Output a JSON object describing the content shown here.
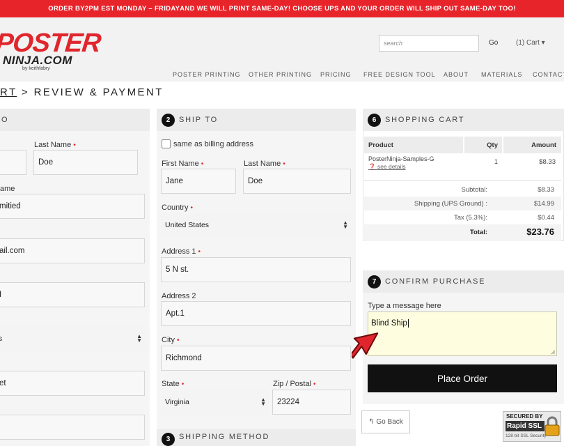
{
  "banner": {
    "text_prefix": "ORDER BY ",
    "text_bold": "2PM EST MONDAY – FRIDAY",
    "text_suffix": " AND WE WILL PRINT SAME-DAY! CHOOSE UPS AND YOUR ORDER WILL SHIP OUT SAME-DAY TOO!"
  },
  "header": {
    "logo_line1": "POSTER",
    "logo_line2": "NINJA.COM",
    "logo_line3": "by keithfabry",
    "search_placeholder": "search",
    "go_label": "Go",
    "cart_label": "(1)  Cart ▾",
    "nav": [
      "POSTER PRINTING",
      "OTHER PRINTING",
      "PRICING",
      "FREE DESIGN TOOL",
      "ABOUT",
      "MATERIALS",
      "CONTACT"
    ]
  },
  "breadcrumb": {
    "link": "RT",
    "separator": " > ",
    "current": "REVIEW & PAYMENT"
  },
  "billing": {
    "title": "O",
    "last_name_label": "Last Name",
    "last_name_value": "Doe",
    "company_label": "ame",
    "company_value": "mitied",
    "email_value": "ail.com",
    "phone_value": "I",
    "country_value": "s",
    "address_value": "et"
  },
  "ship_to": {
    "number": "2",
    "title": "SHIP TO",
    "same_as_billing": "same as billing address",
    "first_name_label": "First Name",
    "first_name_value": "Jane",
    "last_name_label": "Last Name",
    "last_name_value": "Doe",
    "country_label": "Country",
    "country_value": "United States",
    "address1_label": "Address 1",
    "address1_value": "5 N st.",
    "address2_label": "Address 2",
    "address2_value": "Apt.1",
    "city_label": "City",
    "city_value": "Richmond",
    "state_label": "State",
    "state_value": "Virginia",
    "zip_label": "Zip / Postal",
    "zip_value": "23224"
  },
  "shipping_method": {
    "number": "3",
    "title": "SHIPPING METHOD"
  },
  "cart": {
    "number": "6",
    "title": "SHOPPING CART",
    "headers": {
      "product": "Product",
      "qty": "Qty",
      "amount": "Amount"
    },
    "items": [
      {
        "name": "PosterNinja-Samples-G",
        "details": "see details",
        "qty": "1",
        "amount": "$8.33"
      }
    ],
    "subtotal_label": "Subtotal:",
    "subtotal": "$8.33",
    "shipping_label": "Shipping (UPS Ground) :",
    "shipping": "$14.99",
    "tax_label": "Tax (5.3%):",
    "tax": "$0.44",
    "total_label": "Total:",
    "total": "$23.76"
  },
  "confirm": {
    "number": "7",
    "title": "CONFIRM PURCHASE",
    "message_label": "Type a message here",
    "message_value": "Blind Ship",
    "place_order": "Place Order",
    "go_back": "Go Back"
  },
  "ssl_badge": {
    "line1": "SECURED BY",
    "line2": "Rapid SSL",
    "line3": "128 bit SSL Security"
  },
  "colors": {
    "banner": "#e8242b",
    "accent_red": "#e0262c",
    "message_bg": "#fffddf",
    "button": "#111111"
  }
}
